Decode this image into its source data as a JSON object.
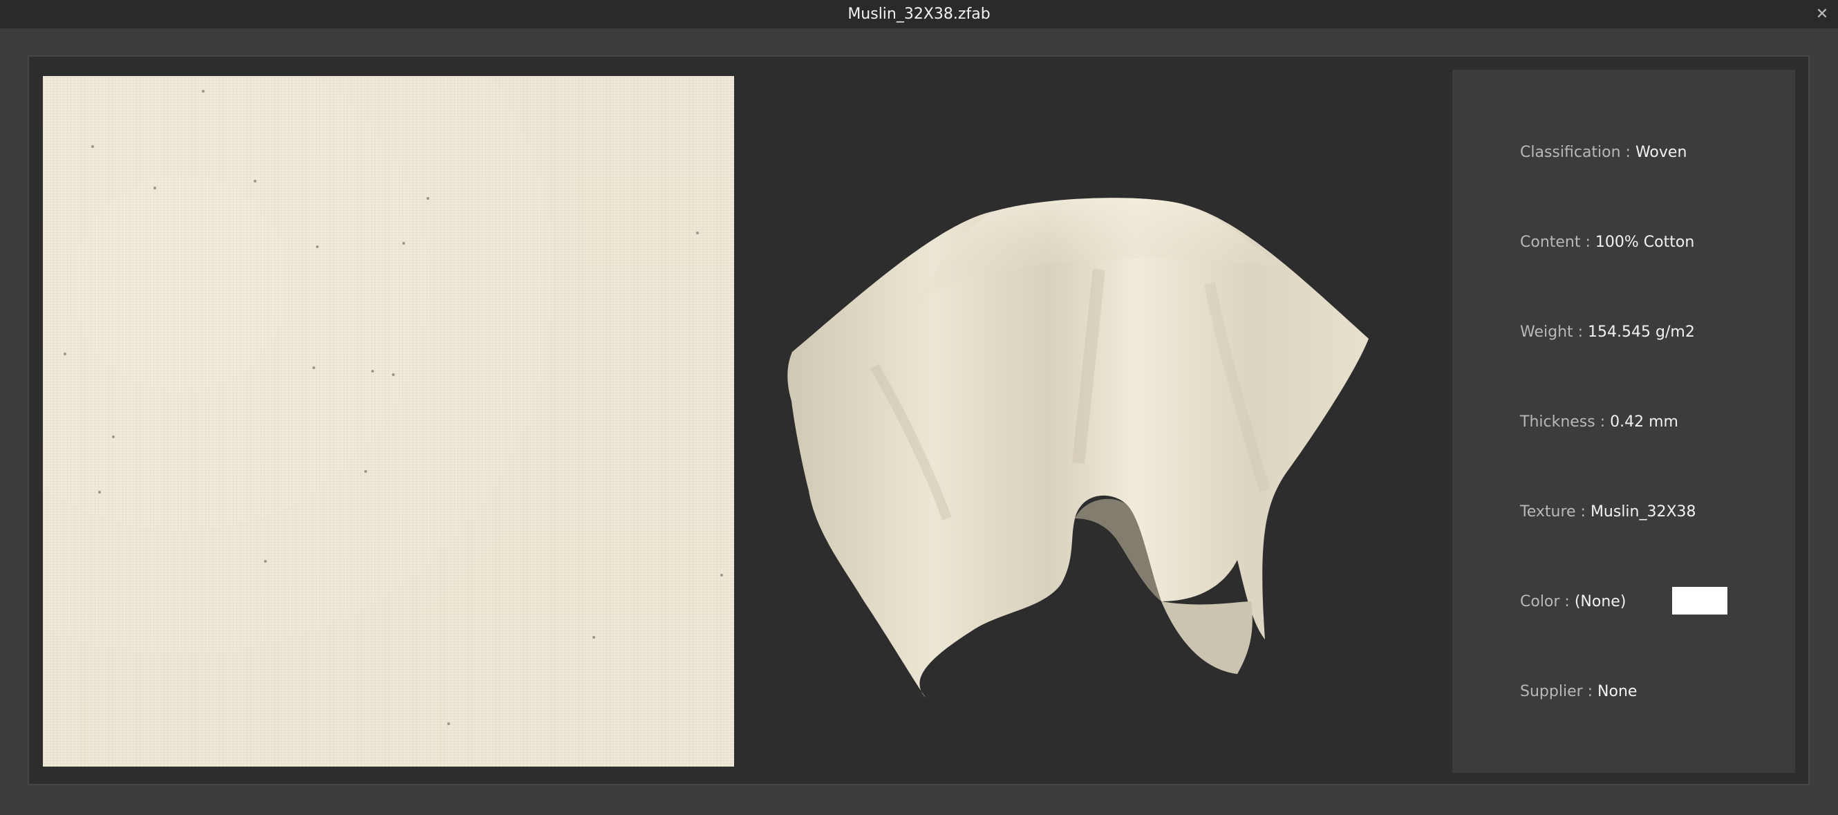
{
  "window": {
    "title": "Muslin_32X38.zfab",
    "close_icon": "close-icon",
    "close_glyph": "✕"
  },
  "fabric": {
    "swatch_color": "#efe8d6",
    "drape_color": "#e9e3d2"
  },
  "properties": [
    {
      "label": "Classification : ",
      "value": "Woven"
    },
    {
      "label": "Content : ",
      "value": "100% Cotton"
    },
    {
      "label": "Weight : ",
      "value": "154.545 g/m2"
    },
    {
      "label": "Thickness : ",
      "value": "0.42 mm"
    },
    {
      "label": "Texture : ",
      "value": "Muslin_32X38"
    },
    {
      "label": "Color : ",
      "value": "(None)"
    },
    {
      "label": "Supplier : ",
      "value": "None"
    }
  ],
  "color_chip": "#ffffff"
}
